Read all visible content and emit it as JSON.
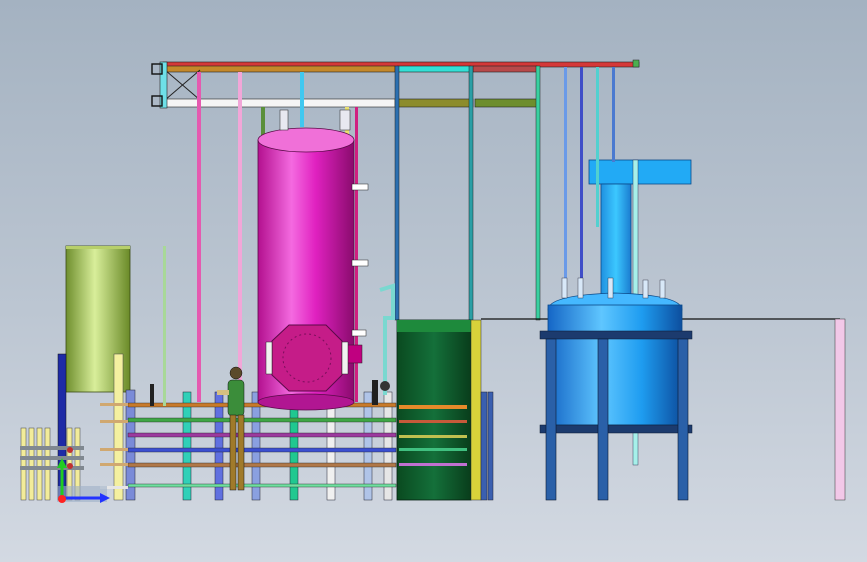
{
  "viewport": {
    "background_top": "#a4b2c1",
    "background_bottom": "#d3d9e2"
  },
  "model": {
    "components": [
      "overhead-frame",
      "vertical-pressure-vessel",
      "manway-cover",
      "green-storage-tank",
      "blue-reactor-vessel",
      "reactor-agitator-drive",
      "reactor-support-legs",
      "pipe-rack",
      "dark-green-cabinet",
      "human-figure-reference",
      "coordinate-triad"
    ],
    "colors": {
      "vessel": "#e21bc2",
      "reactor": "#1f9cf0",
      "storage_tank": "#9fc45a",
      "cabinet": "#0e5a2a",
      "frame_red": "#d53838",
      "frame_cyan": "#33e0d6",
      "frame_olive": "#8c8c2c",
      "triad_x": "#2233ff",
      "triad_y": "#22cc22",
      "triad_z": "#ff2222"
    }
  }
}
